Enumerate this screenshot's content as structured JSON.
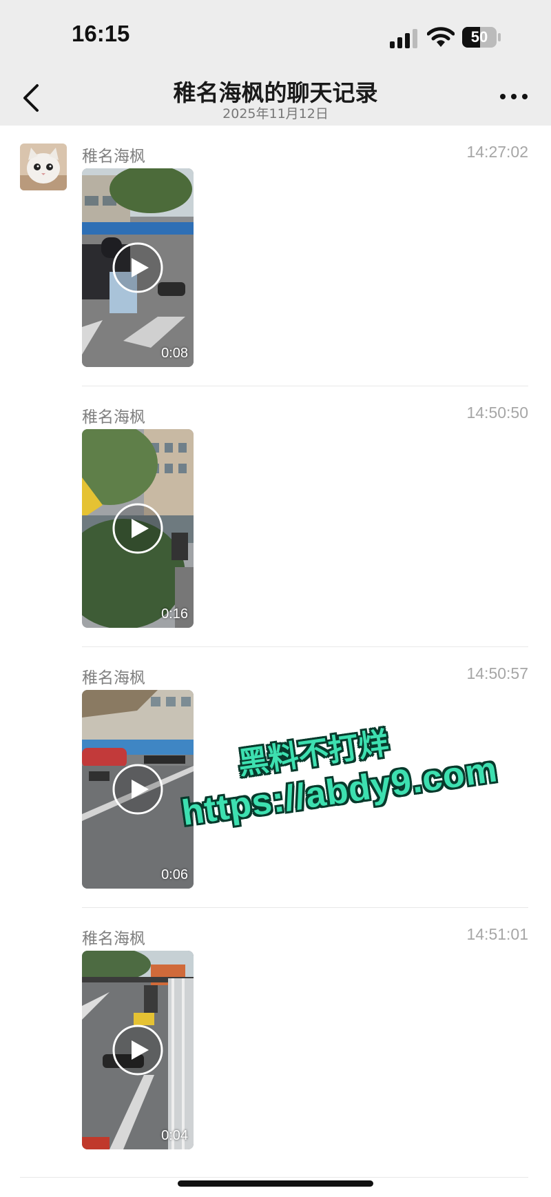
{
  "status_bar": {
    "time": "16:15",
    "battery": "50",
    "icons": [
      "signal-icon",
      "wifi-icon",
      "battery-icon"
    ]
  },
  "nav": {
    "title": "稚名海枫的聊天记录",
    "subtitle": "2025年11月12日",
    "back_icon": "chevron-left-icon",
    "more_icon": "more-dots-icon"
  },
  "messages": [
    {
      "sender": "稚名海枫",
      "time": "14:27:02",
      "duration": "0:08"
    },
    {
      "sender": "稚名海枫",
      "time": "14:50:50",
      "duration": "0:16"
    },
    {
      "sender": "稚名海枫",
      "time": "14:50:57",
      "duration": "0:06"
    },
    {
      "sender": "稚名海枫",
      "time": "14:51:01",
      "duration": "0:04"
    }
  ],
  "watermark": {
    "line1": "黑料不打烊",
    "line2": "https://abdy9.com"
  },
  "colors": {
    "nav_background": "#ededed",
    "watermark_fill": "#3de0b0",
    "watermark_outline": "#083a2c"
  }
}
